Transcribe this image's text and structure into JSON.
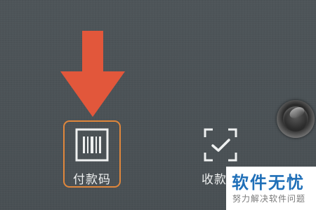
{
  "tiles": {
    "pay": {
      "label": "付款码",
      "icon": "barcode-icon"
    },
    "receive": {
      "label": "收款码",
      "icon": "scan-check-icon"
    }
  },
  "annotation": {
    "icon": "down-arrow-icon",
    "color": "#e2573b"
  },
  "watermark": {
    "title": "软件无忧",
    "subtitle": "努力解决软件问题"
  },
  "colors": {
    "background": "#4a5155",
    "highlight_border": "#e0873c",
    "label_text": "#eef0f0",
    "watermark_blue": "#1f6fb8"
  }
}
